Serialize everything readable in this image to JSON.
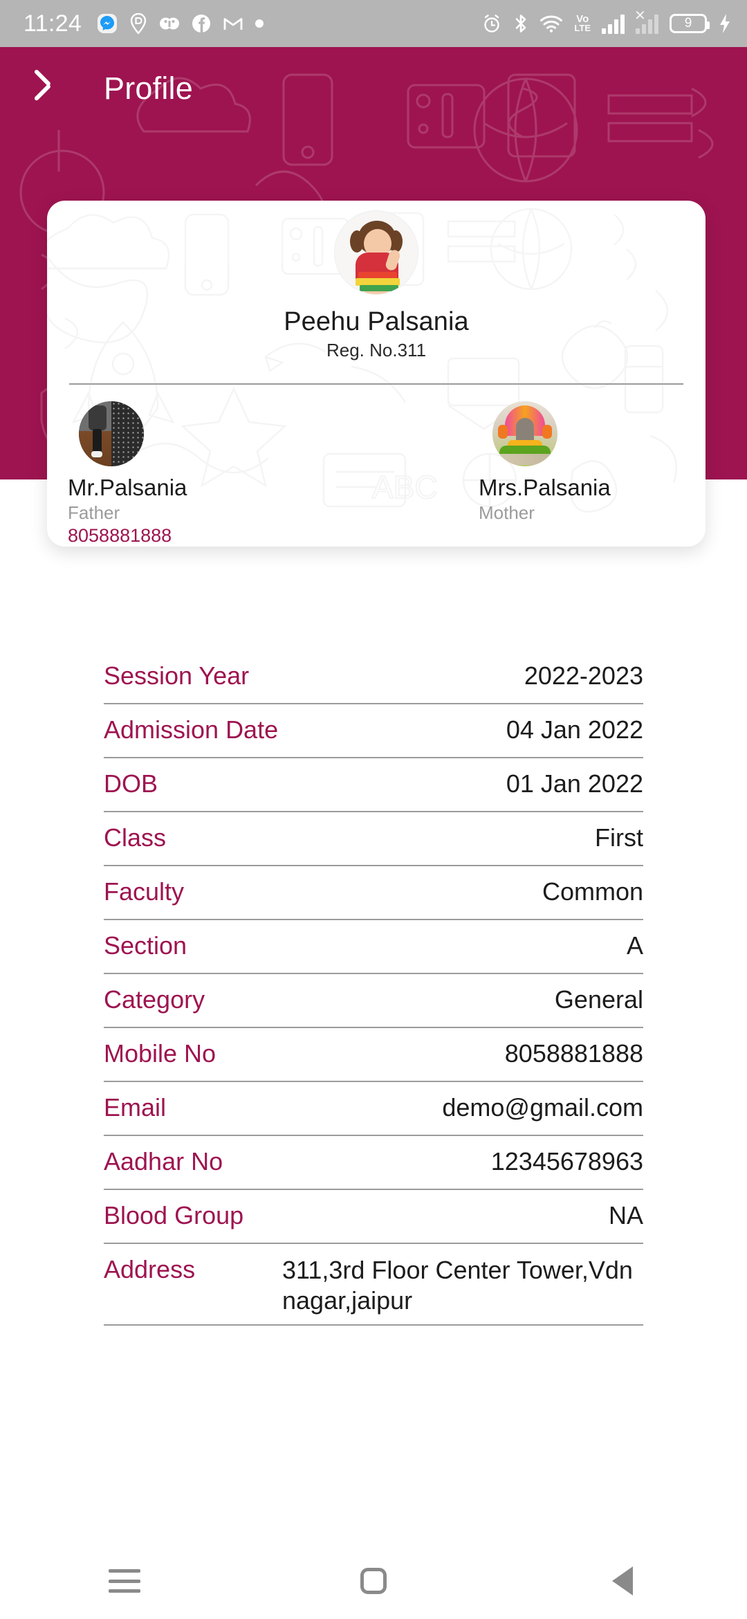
{
  "statusbar": {
    "time": "11:24",
    "left_icons": [
      "messenger-icon",
      "location-pin-icon",
      "mask-icon",
      "facebook-icon",
      "gmail-icon",
      "dot-indicator"
    ],
    "right_icons": [
      "alarm-icon",
      "bluetooth-icon",
      "wifi-icon",
      "volte-icon",
      "signal-bars-icon",
      "signal-off-icon",
      "battery-icon",
      "charging-bolt-icon"
    ],
    "volte_line1": "Vo",
    "volte_line2": "LTE",
    "battery_level": "9",
    "background_color": "#b5b5b5"
  },
  "header": {
    "title": "Profile",
    "back_label": "Back",
    "background_color": "#9e1450"
  },
  "profile_card": {
    "student": {
      "avatar": "student-photo",
      "name": "Peehu Palsania",
      "registration": "Reg. No.311"
    },
    "parents": [
      {
        "avatar": "father-photo",
        "name": "Mr.Palsania",
        "relation": "Father",
        "phone": "8058881888"
      },
      {
        "avatar": "mother-photo",
        "name": "Mrs.Palsania",
        "relation": "Mother",
        "phone": ""
      }
    ]
  },
  "details": {
    "rows": [
      {
        "label": "Session Year",
        "value": "2022-2023"
      },
      {
        "label": "Admission Date",
        "value": "04 Jan 2022"
      },
      {
        "label": "DOB",
        "value": "01 Jan 2022"
      },
      {
        "label": "Class",
        "value": "First"
      },
      {
        "label": "Faculty",
        "value": "Common"
      },
      {
        "label": "Section",
        "value": "A"
      },
      {
        "label": "Category",
        "value": "General"
      },
      {
        "label": "Mobile No",
        "value": "8058881888"
      },
      {
        "label": "Email",
        "value": "demo@gmail.com"
      },
      {
        "label": "Aadhar No",
        "value": "12345678963"
      },
      {
        "label": "Blood Group",
        "value": "NA"
      },
      {
        "label": "Address",
        "value": "311,3rd Floor Center Tower,Vdn nagar,jaipur"
      }
    ]
  },
  "navbar": {
    "recents_label": "Recents",
    "home_label": "Home",
    "back_label": "Back"
  },
  "colors": {
    "accent": "#9e1450",
    "label": "#9e1450",
    "value": "#1c1c1c",
    "muted": "#9b9b9b",
    "divider": "#9b9b9b"
  }
}
